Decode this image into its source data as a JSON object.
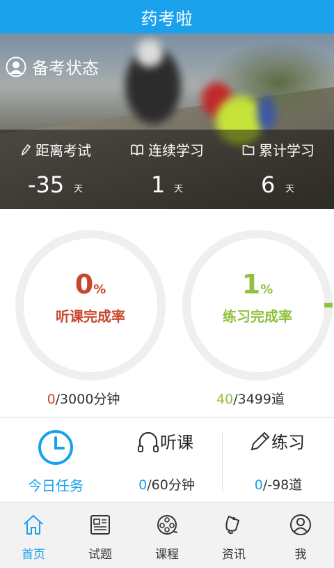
{
  "app": {
    "title": "药考啦"
  },
  "hero": {
    "status_label": "备考状态",
    "stats": [
      {
        "label": "距离考试",
        "value": "-35",
        "unit": "天",
        "icon": "pencil-icon"
      },
      {
        "label": "连续学习",
        "value": "1",
        "unit": "天",
        "icon": "book-icon"
      },
      {
        "label": "累计学习",
        "value": "6",
        "unit": "天",
        "icon": "folder-icon"
      }
    ]
  },
  "progress": {
    "listening": {
      "percent_value": "0",
      "percent_sign": "%",
      "label": "听课完成率",
      "done": "0",
      "total": "/3000分钟",
      "color": "#c8462d",
      "fraction": 0.0
    },
    "practice": {
      "percent_value": "1",
      "percent_sign": "%",
      "label": "练习完成率",
      "done": "40",
      "total": "/3499道",
      "color": "#8fc13d",
      "fraction": 0.01
    }
  },
  "tasks": {
    "today_label": "今日任务",
    "listen_title": "听课",
    "listen_done": "0",
    "listen_total": "/60分钟",
    "practice_title": "练习",
    "practice_done": "0",
    "practice_total": "/-98道"
  },
  "colors": {
    "accent": "#1aa1ec",
    "listen": "#c8462d",
    "practice": "#8fc13d"
  },
  "tabs": [
    {
      "label": "首页",
      "icon": "home-icon",
      "active": true
    },
    {
      "label": "试题",
      "icon": "document-icon",
      "active": false
    },
    {
      "label": "课程",
      "icon": "film-reel-icon",
      "active": false
    },
    {
      "label": "资讯",
      "icon": "bell-icon",
      "active": false
    },
    {
      "label": "我",
      "icon": "user-icon",
      "active": false
    }
  ]
}
